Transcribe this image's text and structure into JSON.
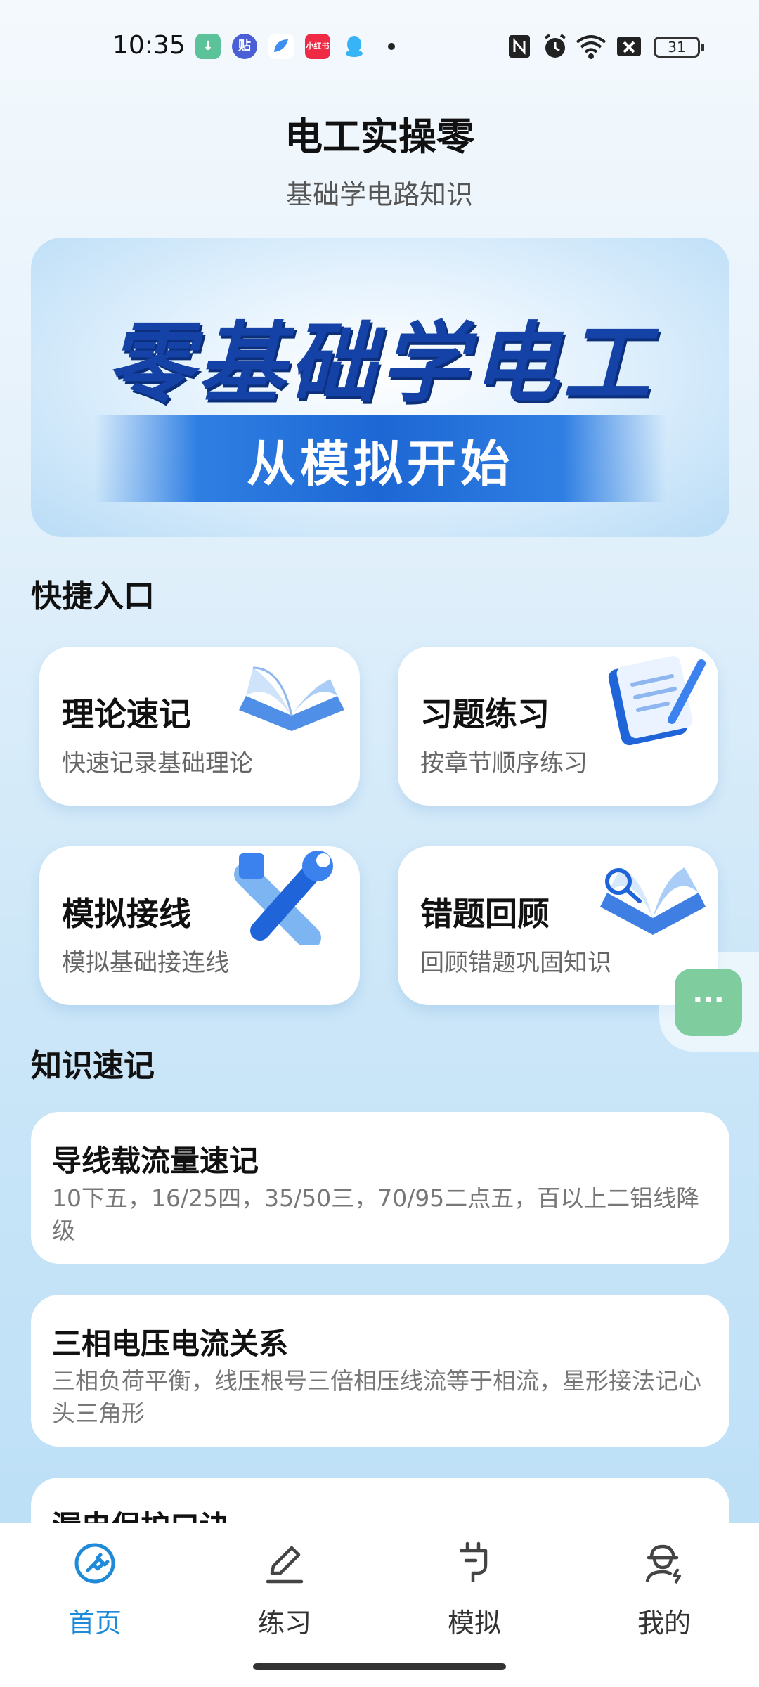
{
  "status_bar": {
    "time": "10:35",
    "battery": "31",
    "notifications": [
      {
        "icon": "download-icon",
        "label": "↓",
        "color": "#5cc29a"
      },
      {
        "icon": "tieba-icon",
        "label": "贴",
        "color": "#4a5fd6"
      },
      {
        "icon": "browser-icon",
        "label": "",
        "color": "#3d8ef0"
      },
      {
        "icon": "xiaohongshu-icon",
        "label": "小红书",
        "color": "#ee2a45"
      },
      {
        "icon": "qq-icon",
        "label": "",
        "color": "#36b4f5"
      }
    ]
  },
  "header": {
    "title": "电工实操零",
    "subtitle": "基础学电路知识"
  },
  "banner": {
    "title": "零基础学电工",
    "subtitle": "从模拟开始"
  },
  "quick_section": {
    "title": "快捷入口",
    "cards": [
      {
        "title": "理论速记",
        "desc": "快速记录基础理论",
        "icon": "open-book-icon"
      },
      {
        "title": "习题练习",
        "desc": "按章节顺序练习",
        "icon": "notebook-pen-icon"
      },
      {
        "title": "模拟接线",
        "desc": "模拟基础接连线",
        "icon": "tools-icon"
      },
      {
        "title": "错题回顾",
        "desc": "回顾错题巩固知识",
        "icon": "book-magnifier-icon"
      }
    ]
  },
  "floating_button": {
    "label": "···",
    "color": "#7fcc9f"
  },
  "knowledge_section": {
    "title": "知识速记",
    "items": [
      {
        "title": "导线载流量速记",
        "desc": "10下五，16/25四，35/50三，70/95二点五，百以上二铝线降级"
      },
      {
        "title": "三相电压电流关系",
        "desc": "三相负荷平衡，线压根号三倍相压线流等于相流，星形接法记心头三角形"
      },
      {
        "title": "漏电保护口诀",
        "desc": ""
      }
    ]
  },
  "bottom_nav": {
    "active_color": "#1f8ad8",
    "items": [
      {
        "label": "首页",
        "icon": "home-plug-icon",
        "active": true
      },
      {
        "label": "练习",
        "icon": "pencil-icon",
        "active": false
      },
      {
        "label": "模拟",
        "icon": "plug-icon",
        "active": false
      },
      {
        "label": "我的",
        "icon": "worker-helmet-icon",
        "active": false
      }
    ]
  }
}
